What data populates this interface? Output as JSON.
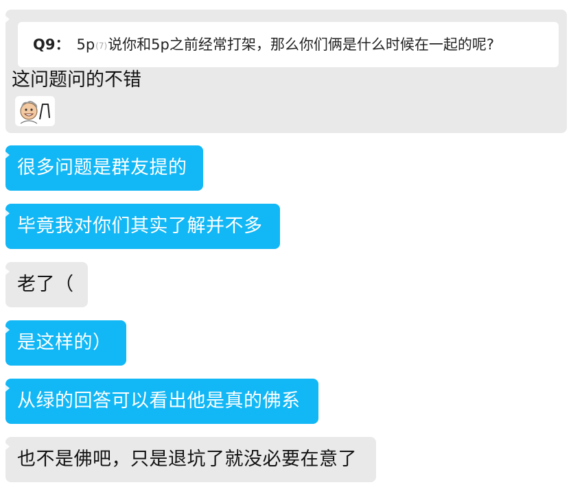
{
  "quote": {
    "label": "Q9：",
    "prefix": "5p",
    "tag": "(7)",
    "question": "说你和5p之前经常打架，那么你们俩是什么时候在一起的呢?",
    "reply": "这问题问的不错",
    "sticker_icon": "grinning-old-man-sticker-icon"
  },
  "messages": [
    {
      "text": "很多问题是群友提的",
      "style": "blue"
    },
    {
      "text": "毕竟我对你们其实了解并不多",
      "style": "blue"
    },
    {
      "text": "老了（",
      "style": "gray"
    },
    {
      "text": "是这样的）",
      "style": "blue"
    },
    {
      "text": "从绿的回答可以看出他是真的佛系",
      "style": "blue"
    },
    {
      "text": "也不是佛吧，只是退坑了就没必要在意了",
      "style": "gray"
    }
  ],
  "colors": {
    "blue_bubble": "#12b7f5",
    "gray_bubble": "#e9e9ea"
  }
}
